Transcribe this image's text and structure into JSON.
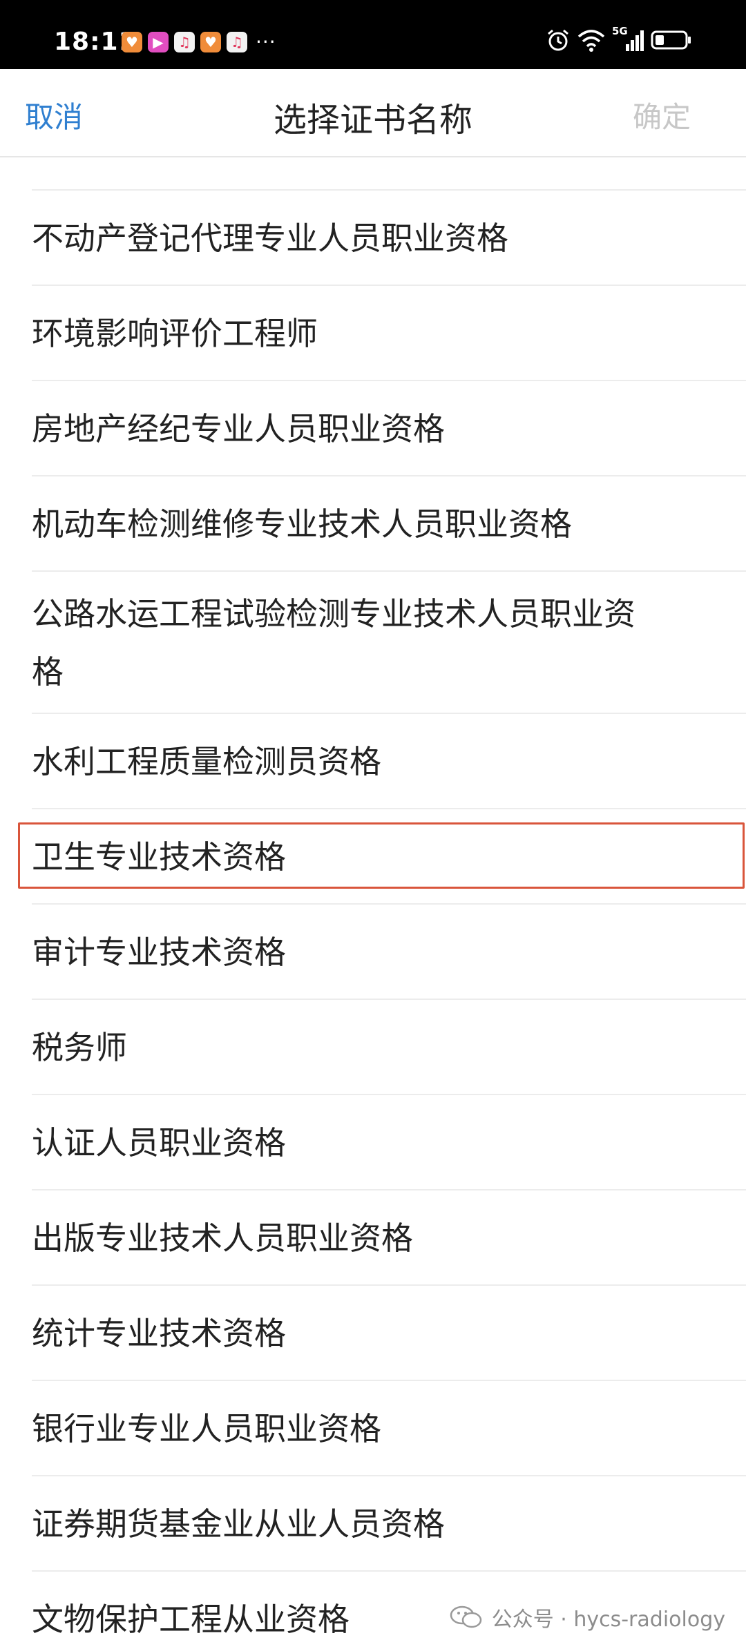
{
  "status_bar": {
    "time": "18:11",
    "more": "···",
    "network_label": "5G",
    "icons": [
      "shield-app-icon",
      "video-app-icon",
      "music-app-icon",
      "shield-app-icon",
      "music-app-icon",
      "alarm-icon",
      "wifi-icon",
      "signal-icon",
      "battery-icon"
    ]
  },
  "header": {
    "cancel_label": "取消",
    "title": "选择证书名称",
    "confirm_label": "确定"
  },
  "list": {
    "items": [
      "不动产登记代理专业人员职业资格",
      "环境影响评价工程师",
      "房地产经纪专业人员职业资格",
      "机动车检测维修专业技术人员职业资格",
      "公路水运工程试验检测专业技术人员职业资格",
      "水利工程质量检测员资格",
      "卫生专业技术资格",
      "审计专业技术资格",
      "税务师",
      "认证人员职业资格",
      "出版专业技术人员职业资格",
      "统计专业技术资格",
      "银行业专业人员职业资格",
      "证券期货基金业从业人员资格",
      "文物保护工程从业资格"
    ],
    "highlighted_item": "卫生专业技术资格"
  },
  "watermark": {
    "text": "公众号 · hycs-radiology"
  },
  "colors": {
    "accent": "#2f7fd0",
    "disabled": "#c7c7c7",
    "highlight": "#d9553b"
  }
}
